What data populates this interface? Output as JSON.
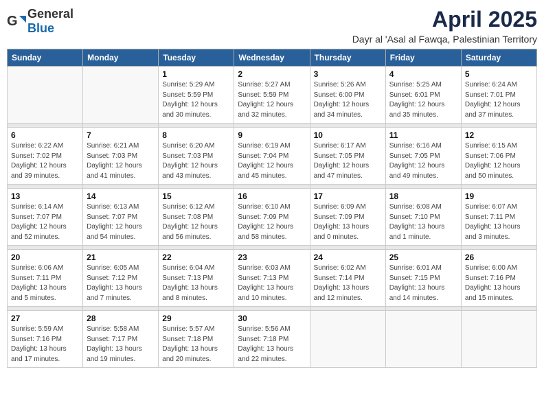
{
  "header": {
    "logo_general": "General",
    "logo_blue": "Blue",
    "month": "April 2025",
    "location": "Dayr al 'Asal al Fawqa, Palestinian Territory"
  },
  "weekdays": [
    "Sunday",
    "Monday",
    "Tuesday",
    "Wednesday",
    "Thursday",
    "Friday",
    "Saturday"
  ],
  "weeks": [
    [
      {
        "day": "",
        "info": ""
      },
      {
        "day": "",
        "info": ""
      },
      {
        "day": "1",
        "info": "Sunrise: 5:29 AM\nSunset: 5:59 PM\nDaylight: 12 hours\nand 30 minutes."
      },
      {
        "day": "2",
        "info": "Sunrise: 5:27 AM\nSunset: 5:59 PM\nDaylight: 12 hours\nand 32 minutes."
      },
      {
        "day": "3",
        "info": "Sunrise: 5:26 AM\nSunset: 6:00 PM\nDaylight: 12 hours\nand 34 minutes."
      },
      {
        "day": "4",
        "info": "Sunrise: 5:25 AM\nSunset: 6:01 PM\nDaylight: 12 hours\nand 35 minutes."
      },
      {
        "day": "5",
        "info": "Sunrise: 6:24 AM\nSunset: 7:01 PM\nDaylight: 12 hours\nand 37 minutes."
      }
    ],
    [
      {
        "day": "6",
        "info": "Sunrise: 6:22 AM\nSunset: 7:02 PM\nDaylight: 12 hours\nand 39 minutes."
      },
      {
        "day": "7",
        "info": "Sunrise: 6:21 AM\nSunset: 7:03 PM\nDaylight: 12 hours\nand 41 minutes."
      },
      {
        "day": "8",
        "info": "Sunrise: 6:20 AM\nSunset: 7:03 PM\nDaylight: 12 hours\nand 43 minutes."
      },
      {
        "day": "9",
        "info": "Sunrise: 6:19 AM\nSunset: 7:04 PM\nDaylight: 12 hours\nand 45 minutes."
      },
      {
        "day": "10",
        "info": "Sunrise: 6:17 AM\nSunset: 7:05 PM\nDaylight: 12 hours\nand 47 minutes."
      },
      {
        "day": "11",
        "info": "Sunrise: 6:16 AM\nSunset: 7:05 PM\nDaylight: 12 hours\nand 49 minutes."
      },
      {
        "day": "12",
        "info": "Sunrise: 6:15 AM\nSunset: 7:06 PM\nDaylight: 12 hours\nand 50 minutes."
      }
    ],
    [
      {
        "day": "13",
        "info": "Sunrise: 6:14 AM\nSunset: 7:07 PM\nDaylight: 12 hours\nand 52 minutes."
      },
      {
        "day": "14",
        "info": "Sunrise: 6:13 AM\nSunset: 7:07 PM\nDaylight: 12 hours\nand 54 minutes."
      },
      {
        "day": "15",
        "info": "Sunrise: 6:12 AM\nSunset: 7:08 PM\nDaylight: 12 hours\nand 56 minutes."
      },
      {
        "day": "16",
        "info": "Sunrise: 6:10 AM\nSunset: 7:09 PM\nDaylight: 12 hours\nand 58 minutes."
      },
      {
        "day": "17",
        "info": "Sunrise: 6:09 AM\nSunset: 7:09 PM\nDaylight: 13 hours\nand 0 minutes."
      },
      {
        "day": "18",
        "info": "Sunrise: 6:08 AM\nSunset: 7:10 PM\nDaylight: 13 hours\nand 1 minute."
      },
      {
        "day": "19",
        "info": "Sunrise: 6:07 AM\nSunset: 7:11 PM\nDaylight: 13 hours\nand 3 minutes."
      }
    ],
    [
      {
        "day": "20",
        "info": "Sunrise: 6:06 AM\nSunset: 7:11 PM\nDaylight: 13 hours\nand 5 minutes."
      },
      {
        "day": "21",
        "info": "Sunrise: 6:05 AM\nSunset: 7:12 PM\nDaylight: 13 hours\nand 7 minutes."
      },
      {
        "day": "22",
        "info": "Sunrise: 6:04 AM\nSunset: 7:13 PM\nDaylight: 13 hours\nand 8 minutes."
      },
      {
        "day": "23",
        "info": "Sunrise: 6:03 AM\nSunset: 7:13 PM\nDaylight: 13 hours\nand 10 minutes."
      },
      {
        "day": "24",
        "info": "Sunrise: 6:02 AM\nSunset: 7:14 PM\nDaylight: 13 hours\nand 12 minutes."
      },
      {
        "day": "25",
        "info": "Sunrise: 6:01 AM\nSunset: 7:15 PM\nDaylight: 13 hours\nand 14 minutes."
      },
      {
        "day": "26",
        "info": "Sunrise: 6:00 AM\nSunset: 7:16 PM\nDaylight: 13 hours\nand 15 minutes."
      }
    ],
    [
      {
        "day": "27",
        "info": "Sunrise: 5:59 AM\nSunset: 7:16 PM\nDaylight: 13 hours\nand 17 minutes."
      },
      {
        "day": "28",
        "info": "Sunrise: 5:58 AM\nSunset: 7:17 PM\nDaylight: 13 hours\nand 19 minutes."
      },
      {
        "day": "29",
        "info": "Sunrise: 5:57 AM\nSunset: 7:18 PM\nDaylight: 13 hours\nand 20 minutes."
      },
      {
        "day": "30",
        "info": "Sunrise: 5:56 AM\nSunset: 7:18 PM\nDaylight: 13 hours\nand 22 minutes."
      },
      {
        "day": "",
        "info": ""
      },
      {
        "day": "",
        "info": ""
      },
      {
        "day": "",
        "info": ""
      }
    ]
  ]
}
